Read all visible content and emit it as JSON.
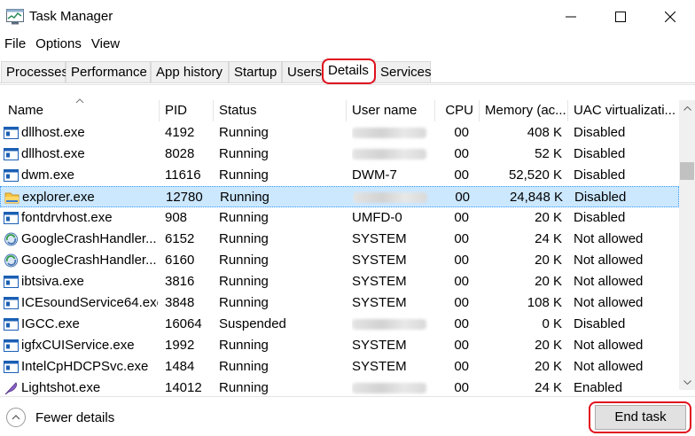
{
  "window": {
    "title": "Task Manager",
    "minimize_icon": "minimize-icon",
    "maximize_icon": "maximize-icon",
    "close_icon": "close-icon"
  },
  "menu": [
    "File",
    "Options",
    "View"
  ],
  "tabs": [
    "Processes",
    "Performance",
    "App history",
    "Startup",
    "Users",
    "Details",
    "Services"
  ],
  "active_tab": "Details",
  "columns": [
    "Name",
    "PID",
    "Status",
    "User name",
    "CPU",
    "Memory (ac...",
    "UAC virtualizati..."
  ],
  "rows": [
    {
      "name": "dllhost.exe",
      "pid": "4192",
      "status": "Running",
      "user": "",
      "user_redacted": true,
      "cpu": "00",
      "memory": "408 K",
      "uac": "Disabled",
      "icon": "window-app-icon"
    },
    {
      "name": "dllhost.exe",
      "pid": "8028",
      "status": "Running",
      "user": "",
      "user_redacted": true,
      "cpu": "00",
      "memory": "52 K",
      "uac": "Disabled",
      "icon": "window-app-icon"
    },
    {
      "name": "dwm.exe",
      "pid": "11616",
      "status": "Running",
      "user": "DWM-7",
      "user_redacted": false,
      "cpu": "00",
      "memory": "52,520 K",
      "uac": "Disabled",
      "icon": "window-app-icon"
    },
    {
      "name": "explorer.exe",
      "pid": "12780",
      "status": "Running",
      "user": "",
      "user_redacted": true,
      "cpu": "00",
      "memory": "24,848 K",
      "uac": "Disabled",
      "icon": "folder-icon",
      "selected": true
    },
    {
      "name": "fontdrvhost.exe",
      "pid": "908",
      "status": "Running",
      "user": "UMFD-0",
      "user_redacted": false,
      "cpu": "00",
      "memory": "20 K",
      "uac": "Disabled",
      "icon": "window-app-icon"
    },
    {
      "name": "GoogleCrashHandler....",
      "pid": "6152",
      "status": "Running",
      "user": "SYSTEM",
      "user_redacted": false,
      "cpu": "00",
      "memory": "24 K",
      "uac": "Not allowed",
      "icon": "google-update-icon"
    },
    {
      "name": "GoogleCrashHandler....",
      "pid": "6160",
      "status": "Running",
      "user": "SYSTEM",
      "user_redacted": false,
      "cpu": "00",
      "memory": "20 K",
      "uac": "Not allowed",
      "icon": "google-update-icon"
    },
    {
      "name": "ibtsiva.exe",
      "pid": "3816",
      "status": "Running",
      "user": "SYSTEM",
      "user_redacted": false,
      "cpu": "00",
      "memory": "20 K",
      "uac": "Not allowed",
      "icon": "window-app-icon"
    },
    {
      "name": "ICEsoundService64.exe",
      "pid": "3848",
      "status": "Running",
      "user": "SYSTEM",
      "user_redacted": false,
      "cpu": "00",
      "memory": "108 K",
      "uac": "Not allowed",
      "icon": "window-app-icon"
    },
    {
      "name": "IGCC.exe",
      "pid": "16064",
      "status": "Suspended",
      "user": "",
      "user_redacted": true,
      "cpu": "00",
      "memory": "0 K",
      "uac": "Disabled",
      "icon": "window-app-icon"
    },
    {
      "name": "igfxCUIService.exe",
      "pid": "1992",
      "status": "Running",
      "user": "SYSTEM",
      "user_redacted": false,
      "cpu": "00",
      "memory": "20 K",
      "uac": "Not allowed",
      "icon": "window-app-icon"
    },
    {
      "name": "IntelCpHDCPSvc.exe",
      "pid": "1484",
      "status": "Running",
      "user": "SYSTEM",
      "user_redacted": false,
      "cpu": "00",
      "memory": "20 K",
      "uac": "Not allowed",
      "icon": "window-app-icon"
    },
    {
      "name": "Lightshot.exe",
      "pid": "14012",
      "status": "Running",
      "user": "",
      "user_redacted": true,
      "cpu": "00",
      "memory": "24 K",
      "uac": "Enabled",
      "icon": "feather-icon"
    }
  ],
  "footer": {
    "fewer_details": "Fewer details",
    "end_task": "End task"
  },
  "colors": {
    "highlight_red": "#e0101e",
    "selection_bg": "#cce8ff",
    "icon_blue": "#1a5fb4"
  }
}
